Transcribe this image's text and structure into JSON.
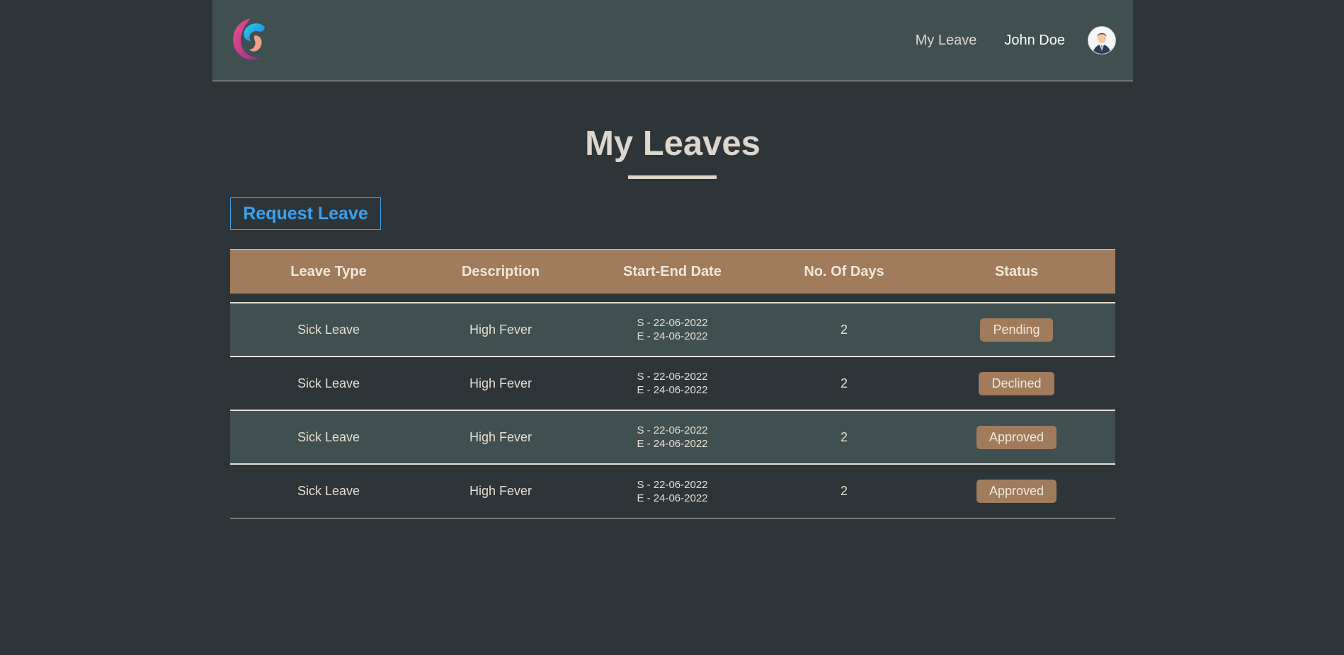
{
  "nav": {
    "my_leave": "My Leave",
    "user_name": "John Doe"
  },
  "page": {
    "title": "My Leaves",
    "request_button": "Request Leave"
  },
  "table": {
    "headers": [
      "Leave Type",
      "Description",
      "Start-End Date",
      "No. Of Days",
      "Status"
    ],
    "rows": [
      {
        "type": "Sick Leave",
        "description": "High Fever",
        "start": "S - 22-06-2022",
        "end": "E - 24-06-2022",
        "days": "2",
        "status": "Pending"
      },
      {
        "type": "Sick Leave",
        "description": "High Fever",
        "start": "S - 22-06-2022",
        "end": "E - 24-06-2022",
        "days": "2",
        "status": "Declined"
      },
      {
        "type": "Sick Leave",
        "description": "High Fever",
        "start": "S - 22-06-2022",
        "end": "E - 24-06-2022",
        "days": "2",
        "status": "Approved"
      },
      {
        "type": "Sick Leave",
        "description": "High Fever",
        "start": "S - 22-06-2022",
        "end": "E - 24-06-2022",
        "days": "2",
        "status": "Approved"
      }
    ]
  },
  "colors": {
    "background": "#2d3539",
    "header_bg": "#405050",
    "accent": "#a07b5c",
    "link_blue": "#3aa2f0"
  },
  "icons": {
    "logo": "swirl-logo-icon",
    "avatar": "user-avatar-icon"
  }
}
